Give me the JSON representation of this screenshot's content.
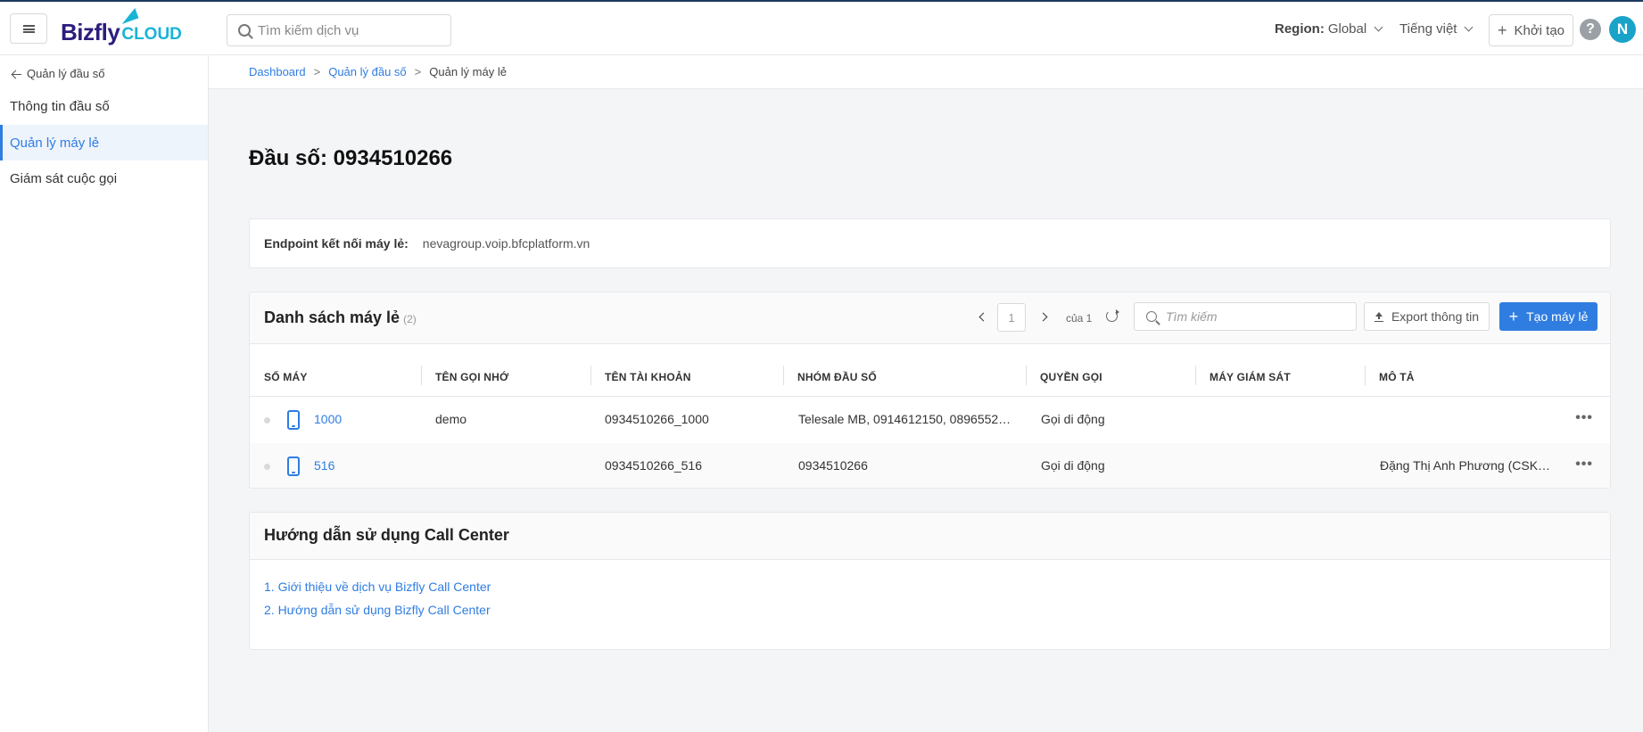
{
  "header": {
    "logo_main": "Bizfly",
    "logo_sub": "CLOUD",
    "search_placeholder": "Tìm kiếm dịch vụ",
    "region_label": "Region:",
    "region_value": "Global",
    "language": "Tiếng việt",
    "create_label": "Khởi tạo",
    "help_symbol": "?",
    "avatar_initial": "N"
  },
  "sidebar": {
    "back_label": "Quản lý đầu số",
    "items": [
      {
        "label": "Thông tin đầu số",
        "active": false
      },
      {
        "label": "Quản lý máy lẻ",
        "active": true
      },
      {
        "label": "Giám sát cuộc gọi",
        "active": false
      }
    ]
  },
  "breadcrumb": [
    "Dashboard",
    "Quản lý đầu số",
    "Quản lý máy lẻ"
  ],
  "page_title": "Đầu số: 0934510266",
  "endpoint": {
    "label": "Endpoint kết nối máy lẻ:",
    "value": "nevagroup.voip.bfcplatform.vn"
  },
  "extensions": {
    "title": "Danh sách máy lẻ",
    "count": "(2)",
    "pager": {
      "page": "1",
      "of": "của 1"
    },
    "search_placeholder": "Tìm kiếm",
    "export_label": "Export thông tin",
    "create_label": "Tạo máy lẻ",
    "columns": [
      "SỐ MÁY",
      "TÊN GỌI NHỚ",
      "TÊN TÀI KHOẢN",
      "NHÓM ĐẦU SỐ",
      "QUYỀN GỌI",
      "MÁY GIÁM SÁT",
      "MÔ TẢ"
    ],
    "rows": [
      {
        "ext": "1000",
        "nickname": "demo",
        "account": "0934510266_1000",
        "group": "Telesale MB, 0914612150, 0896552…",
        "permission": "Gọi di động",
        "monitor": "",
        "description": ""
      },
      {
        "ext": "516",
        "nickname": "",
        "account": "0934510266_516",
        "group": "0934510266",
        "permission": "Gọi di động",
        "monitor": "",
        "description": "Đặng Thị Anh Phương (CSK…"
      }
    ],
    "more_symbol": "•••"
  },
  "guide": {
    "title": "Hướng dẫn sử dụng Call Center",
    "links": [
      "1. Giới thiệu về dịch vụ Bizfly Call Center",
      "2. Hướng dẫn sử dụng Bizfly Call Center"
    ]
  },
  "colors": {
    "accent": "#2f7de1",
    "brand_dark": "#2b1d7c",
    "brand_light": "#18b4d6"
  }
}
